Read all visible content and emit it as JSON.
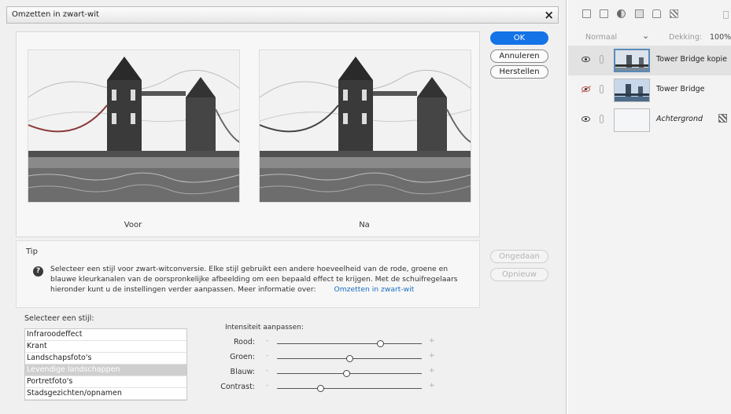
{
  "dialog": {
    "title": "Omzetten in zwart-wit",
    "preview": {
      "before_label": "Voor",
      "after_label": "Na"
    },
    "tip": {
      "heading": "Tip",
      "body": "Selecteer een stijl voor zwart-witconversie. Elke stijl gebruikt een andere hoeveelheid van de rode, groene en blauwe kleurkanalen van de oorspronkelijke afbeelding om een bepaald effect te krijgen. Met de schuifregelaars hieronder kunt u de instellingen verder aanpassen. Meer informatie over:",
      "link": "Omzetten in zwart-wit"
    },
    "style_list": {
      "label": "Selecteer een stijl:",
      "items": [
        "Infraroodeffect",
        "Krant",
        "Landschapsfoto's",
        "Levendige landschappen",
        "Portretfoto's",
        "Stadsgezichten/opnamen"
      ],
      "selected": "Levendige landschappen"
    },
    "intensity": {
      "label": "Intensiteit aanpassen:",
      "minus": "-",
      "plus": "+",
      "sliders": [
        {
          "label": "Rood:",
          "value": 0.71
        },
        {
          "label": "Groen:",
          "value": 0.5
        },
        {
          "label": "Blauw:",
          "value": 0.48
        },
        {
          "label": "Contrast:",
          "value": 0.3
        }
      ]
    },
    "buttons": {
      "ok": "OK",
      "cancel": "Annuleren",
      "reset": "Herstellen",
      "undo": "Ongedaan",
      "redo": "Opnieuw"
    },
    "close_glyph": "✕"
  },
  "layers_panel": {
    "blend_mode": "Normaal",
    "opacity_label": "Dekking:",
    "opacity_value": "100%",
    "layers": [
      {
        "name": "Tower Bridge kopie",
        "visible": true,
        "active": true
      },
      {
        "name": "Tower Bridge",
        "visible": false,
        "active": false
      },
      {
        "name": "Achtergrond",
        "visible": true,
        "active": false,
        "italic": true,
        "locked": true
      }
    ]
  },
  "colors": {
    "accent": "#1473e6",
    "link": "#1a6cc0",
    "selected_row": "#cfcfcf"
  }
}
